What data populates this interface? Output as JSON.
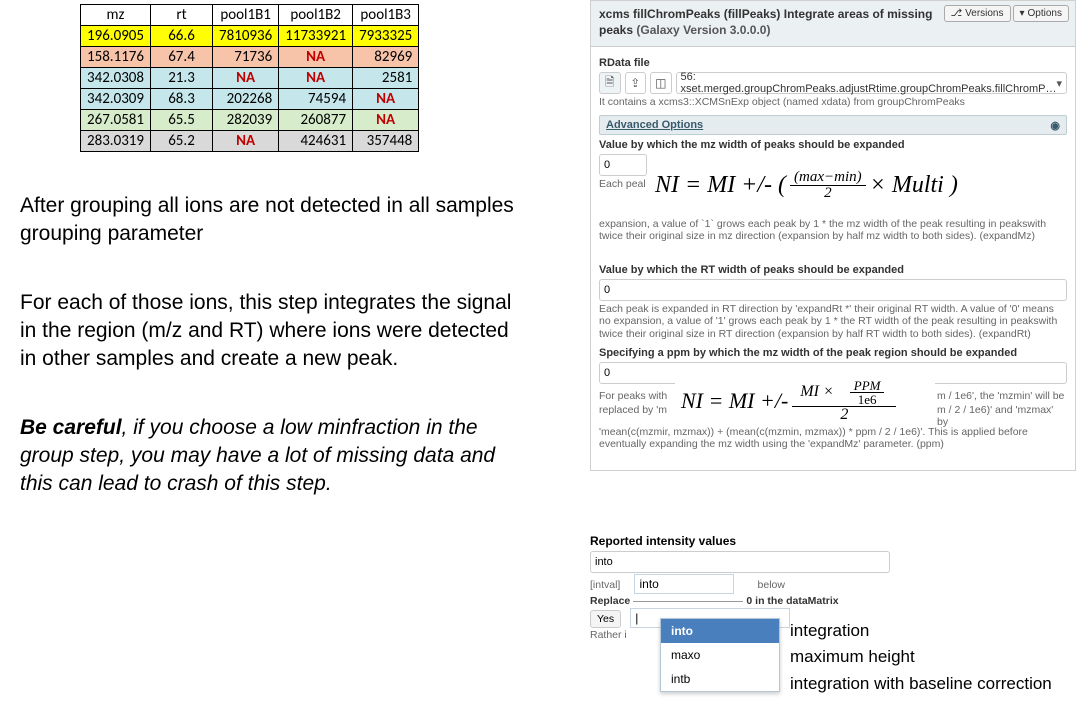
{
  "table": {
    "headers": [
      "mz",
      "rt",
      "pool1B1",
      "pool1B2",
      "pool1B3"
    ],
    "rows": [
      {
        "cls": "row-y",
        "c": [
          "196.0905",
          "66.6",
          "7810936",
          "11733921",
          "7933325"
        ]
      },
      {
        "cls": "row-s",
        "c": [
          "158.1176",
          "67.4",
          "71736",
          "NA",
          "82969"
        ]
      },
      {
        "cls": "row-b",
        "c": [
          "342.0308",
          "21.3",
          "NA",
          "NA",
          "2581"
        ]
      },
      {
        "cls": "row-b",
        "c": [
          "342.0309",
          "68.3",
          "202268",
          "74594",
          "NA"
        ]
      },
      {
        "cls": "row-g",
        "c": [
          "267.0581",
          "65.5",
          "282039",
          "260877",
          "NA"
        ]
      },
      {
        "cls": "row-gray",
        "c": [
          "283.0319",
          "65.2",
          "NA",
          "424631",
          "357448"
        ]
      }
    ]
  },
  "text": {
    "p1": "After grouping all ions are not detected in all samples grouping parameter",
    "p2": "For each of those ions, this step integrates the signal in the region (m/z and  RT) where ions were detected in other samples and create a new peak.",
    "p3_bold": "Be careful",
    "p3_rest": ", if you choose a low minfraction in the group step, you may have a lot of missing data and this can lead to crash of this step."
  },
  "galaxy": {
    "title": "xcms fillChromPeaks (fillPeaks) Integrate areas of missing peaks",
    "version": "(Galaxy Version 3.0.0.0)",
    "btn_versions": "Versions",
    "btn_options": "Options",
    "rdata_label": "RData file",
    "file_value": "56: xset.merged.groupChromPeaks.adjustRtime.groupChromPeaks.fillChromP…",
    "file_help": "It contains a xcms3::XCMSnExp object (named xdata) from groupChromPeaks",
    "adv_label": "Advanced Options",
    "mz_label": "Value by which the mz width of peaks should be expanded",
    "mz_value": "0",
    "mz_each": "Each peal",
    "mz_help2": "expansion, a value of `1` grows each peak by 1 * the mz width of the peak resulting in peakswith twice their original size in mz direction (expansion by half mz width to both sides). (expandMz)",
    "rt_label": "Value by which the RT width of peaks should be expanded",
    "rt_value": "0",
    "rt_help": "Each peak is expanded in RT direction by 'expandRt *' their original RT width. A value of '0' means no expansion, a value of '1' grows each peak by 1 * the RT width of the peak resulting in peakswith twice their original size in RT direction (expansion by half RT width to both sides). (expandRt)",
    "ppm_label": "Specifying a ppm by which the mz width of the peak region should be expanded",
    "ppm_value": "0",
    "ppm_help1": "For peaks with",
    "ppm_help2": "m / 1e6', the 'mzmin' will be",
    "ppm_help3": "replaced by 'm",
    "ppm_help4": "m / 2 / 1e6)' and 'mzmax' by",
    "ppm_help5": "'mean(c(mzmir, mzmax)) + (mean(c(mzmin, mzmax)) * ppm / 2 / 1e6)'. This is applied before eventually expanding the mz width using the 'expandMz' parameter. (ppm)"
  },
  "formula1": {
    "lhs": "NI = MI +/- (",
    "frac_num": "(max−min)",
    "frac_den": "2",
    "times": " × Multi )"
  },
  "formula2": {
    "lhs": "NI = MI +/- ",
    "top_num": "MI ×",
    "ppm": "PPM",
    "one_e6": "1e6",
    "den": "2"
  },
  "intensity": {
    "header": "Reported intensity values",
    "field_value": "into",
    "intval_lbl": "[intval]",
    "intval_val": "into",
    "below": "below",
    "replace_lbl": "Replace",
    "replace_after": "0 in the dataMatrix",
    "yes": "Yes",
    "rather": "Rather i",
    "options": [
      "into",
      "maxo",
      "intb"
    ],
    "defs": [
      "integration",
      "maximum height",
      "integration with baseline correction"
    ]
  }
}
